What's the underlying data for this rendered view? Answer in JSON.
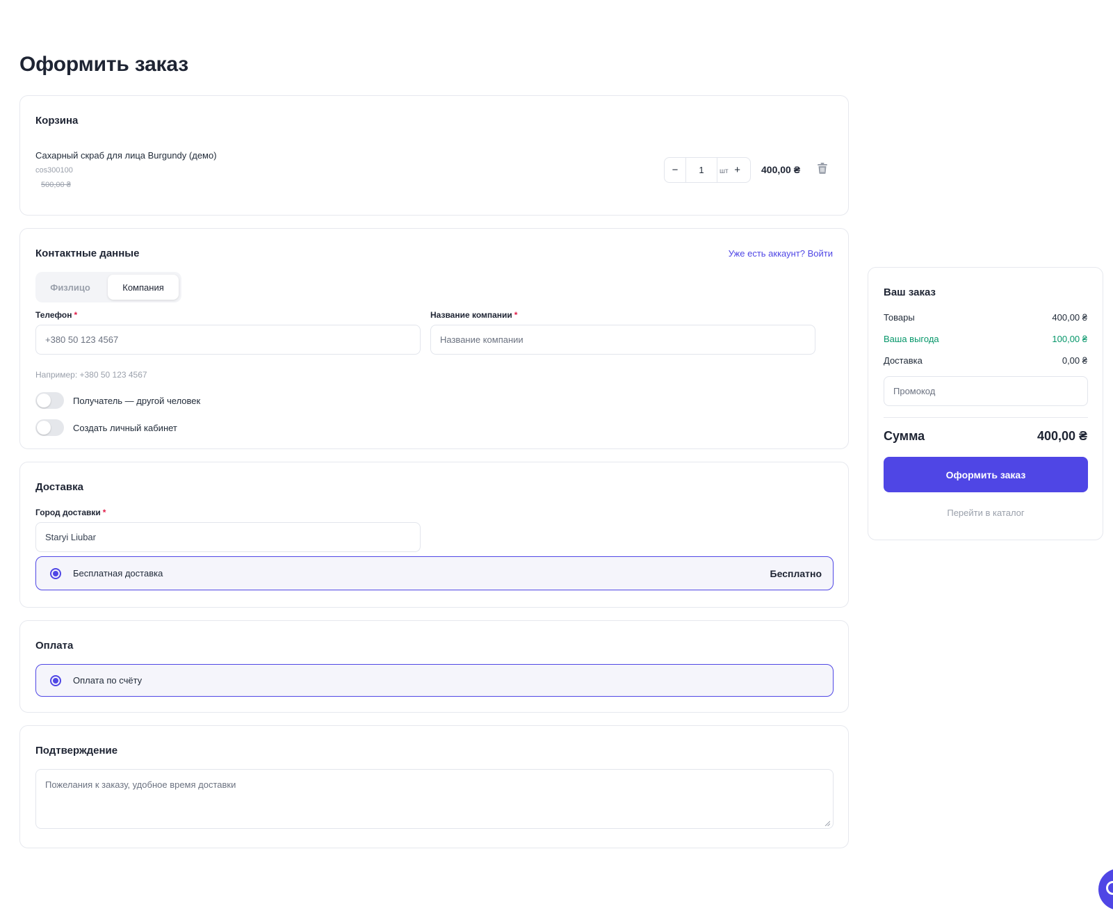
{
  "page": {
    "title": "Оформить заказ"
  },
  "cart": {
    "title": "Корзина",
    "item": {
      "name": "Сахарный скраб для лица Burgundy (демо)",
      "sku": "cos300100",
      "old_price": "500,00 ₴",
      "quantity": "1",
      "unit": "шт",
      "minus": "−",
      "plus": "+",
      "price": "400,00 ₴",
      "delete_icon": "trash-icon"
    }
  },
  "contacts": {
    "title": "Контактные данные",
    "login_link": "Уже есть аккаунт? Войти",
    "segments": {
      "individual": "Физлицо",
      "company": "Компания",
      "selected": "Компания"
    },
    "phone": {
      "label": "Телефон",
      "required": "*",
      "placeholder": "+380 50 123 4567",
      "hint": "Например: +380 50 123 4567"
    },
    "company_name": {
      "label": "Название компании",
      "required": "*",
      "placeholder": "Название компании"
    },
    "toggles": [
      {
        "label": "Получатель — другой человек",
        "on": false
      },
      {
        "label": "Создать личный кабинет",
        "on": false
      }
    ]
  },
  "delivery": {
    "title": "Доставка",
    "city": {
      "label": "Город доставки",
      "required": "*",
      "value": "Staryi Liubar"
    },
    "option": {
      "label": "Бесплатная доставка",
      "price": "Бесплатно",
      "selected": true
    }
  },
  "payment": {
    "title": "Оплата",
    "option": {
      "label": "Оплата по счёту",
      "selected": true
    }
  },
  "confirmation": {
    "title": "Подтверждение",
    "comment_placeholder": "Пожелания к заказу, удобное время доставки"
  },
  "summary": {
    "title": "Ваш заказ",
    "items_label": "Товары",
    "items_value": "400,00 ₴",
    "savings_label": "Ваша выгода",
    "savings_value": "100,00 ₴",
    "delivery_label": "Доставка",
    "delivery_value": "0,00 ₴",
    "promo_placeholder": "Промокод",
    "total_label": "Сумма",
    "total_value": "400,00 ₴",
    "submit": "Оформить заказ",
    "catalog_link": "Перейти в каталог"
  },
  "colors": {
    "accent": "#4f46e5",
    "savings": "#059669",
    "required": "#e11d48"
  }
}
